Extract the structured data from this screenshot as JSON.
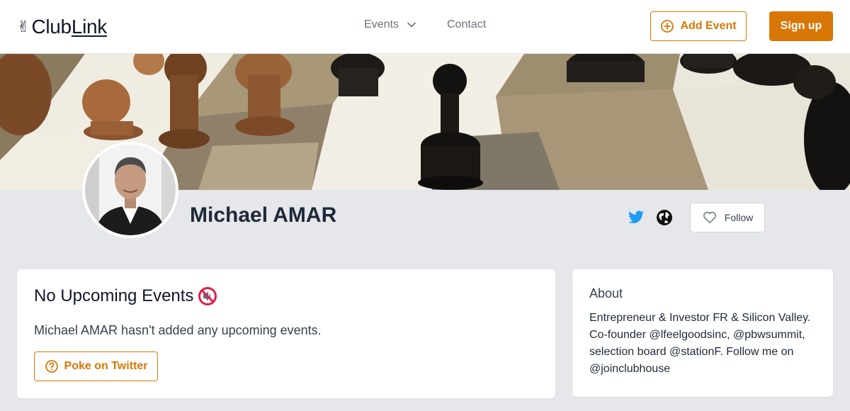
{
  "header": {
    "logo_emoji": "✌",
    "logo_word1": "Club",
    "logo_word2": "Link",
    "nav": {
      "events_label": "Events",
      "contact_label": "Contact"
    },
    "add_event_label": "Add Event",
    "sign_up_label": "Sign up"
  },
  "profile": {
    "name": "Michael AMAR",
    "follow_label": "Follow",
    "links": [
      "twitter-icon",
      "globe-icon"
    ]
  },
  "events_card": {
    "title": "No Upcoming Events",
    "title_emoji_icon": "muted-speaker-icon",
    "message": "Michael AMAR hasn't added any upcoming events.",
    "poke_label": "Poke on Twitter"
  },
  "about_card": {
    "title": "About",
    "text": "Entrepreneur & Investor FR & Silicon Valley. Co-founder @lfeelgoodsinc, @pbwsummit, selection board @stationF. Follow me on @joinclubhouse"
  },
  "colors": {
    "accent": "#d97706",
    "twitter": "#1d9bf0",
    "page_bg": "#e5e7eb"
  }
}
